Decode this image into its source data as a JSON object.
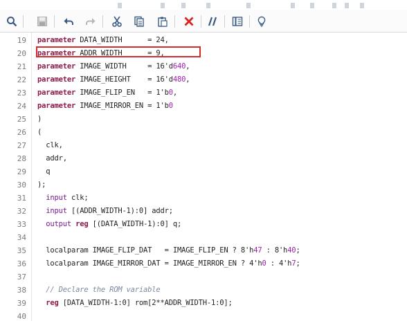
{
  "toolbar": {
    "items": [
      {
        "name": "search"
      },
      {
        "name": "save"
      },
      {
        "name": "undo"
      },
      {
        "name": "redo"
      },
      {
        "name": "cut"
      },
      {
        "name": "copy"
      },
      {
        "name": "paste"
      },
      {
        "name": "delete"
      },
      {
        "name": "comment"
      },
      {
        "name": "columns"
      },
      {
        "name": "bulb"
      }
    ],
    "colors": {
      "delete": "#d7261c",
      "icon": "#3a5a85",
      "disabled": "#b8b8b8"
    }
  },
  "editor": {
    "highlight_color": "#d32a2a",
    "lines": [
      {
        "num": "19",
        "parts": [
          [
            "kw",
            "parameter"
          ],
          [
            "t",
            " DATA_WIDTH      = 24,"
          ]
        ]
      },
      {
        "num": "20",
        "parts": [
          [
            "kw",
            "parameter"
          ],
          [
            "t",
            " ADDR_WIDTH      = 9,"
          ]
        ]
      },
      {
        "num": "21",
        "parts": [
          [
            "kw",
            "parameter"
          ],
          [
            "t",
            " IMAGE_WIDTH     = 16'd"
          ],
          [
            "num",
            "640"
          ],
          [
            "t",
            ","
          ]
        ]
      },
      {
        "num": "22",
        "parts": [
          [
            "kw",
            "parameter"
          ],
          [
            "t",
            " IMAGE_HEIGHT    = 16'd"
          ],
          [
            "num",
            "480"
          ],
          [
            "t",
            ","
          ]
        ]
      },
      {
        "num": "23",
        "parts": [
          [
            "kw",
            "parameter"
          ],
          [
            "t",
            " IMAGE_FLIP_EN   = 1'b"
          ],
          [
            "num",
            "0"
          ],
          [
            "t",
            ","
          ]
        ]
      },
      {
        "num": "24",
        "parts": [
          [
            "kw",
            "parameter"
          ],
          [
            "t",
            " IMAGE_MIRROR_EN = 1'b"
          ],
          [
            "num",
            "0"
          ]
        ]
      },
      {
        "num": "25",
        "parts": [
          [
            "t",
            ")"
          ]
        ]
      },
      {
        "num": "26",
        "parts": [
          [
            "t",
            "("
          ]
        ]
      },
      {
        "num": "27",
        "parts": [
          [
            "t",
            "  clk,"
          ]
        ]
      },
      {
        "num": "28",
        "parts": [
          [
            "t",
            "  addr,"
          ]
        ]
      },
      {
        "num": "29",
        "parts": [
          [
            "t",
            "  q"
          ]
        ]
      },
      {
        "num": "30",
        "parts": [
          [
            "t",
            ");"
          ]
        ]
      },
      {
        "num": "31",
        "parts": [
          [
            "t",
            "  "
          ],
          [
            "kw2",
            "input"
          ],
          [
            "t",
            " clk;"
          ]
        ]
      },
      {
        "num": "32",
        "parts": [
          [
            "t",
            "  "
          ],
          [
            "kw2",
            "input"
          ],
          [
            "t",
            " [(ADDR_WIDTH-1):0] addr;"
          ]
        ]
      },
      {
        "num": "33",
        "parts": [
          [
            "t",
            "  "
          ],
          [
            "kw2",
            "output"
          ],
          [
            "t",
            " "
          ],
          [
            "kw",
            "reg"
          ],
          [
            "t",
            " [(DATA_WIDTH-1):0] q;"
          ]
        ]
      },
      {
        "num": "34",
        "parts": []
      },
      {
        "num": "35",
        "parts": [
          [
            "t",
            "  localparam IMAGE_FLIP_DAT   = IMAGE_FLIP_EN ? 8'h"
          ],
          [
            "num",
            "47"
          ],
          [
            "t",
            " : 8'h"
          ],
          [
            "num",
            "40"
          ],
          [
            "t",
            ";"
          ]
        ]
      },
      {
        "num": "36",
        "parts": [
          [
            "t",
            "  localparam IMAGE_MIRROR_DAT = IMAGE_MIRROR_EN ? 4'h"
          ],
          [
            "num",
            "0"
          ],
          [
            "t",
            " : 4'h"
          ],
          [
            "num",
            "7"
          ],
          [
            "t",
            ";"
          ]
        ]
      },
      {
        "num": "37",
        "parts": []
      },
      {
        "num": "38",
        "parts": [
          [
            "t",
            "  "
          ],
          [
            "cmt",
            "// Declare the ROM variable"
          ]
        ]
      },
      {
        "num": "39",
        "parts": [
          [
            "t",
            "  "
          ],
          [
            "kw",
            "reg"
          ],
          [
            "t",
            " [DATA_WIDTH-1:0] rom[2**ADDR_WIDTH-1:0];"
          ]
        ]
      },
      {
        "num": "40",
        "parts": []
      }
    ]
  }
}
